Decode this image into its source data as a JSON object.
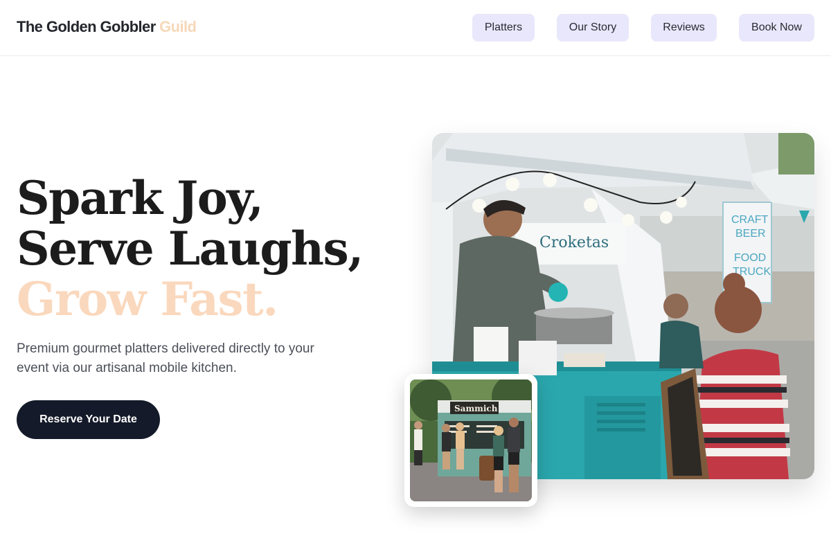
{
  "header": {
    "brand_main": "The Golden Gobbler",
    "brand_accent": "Guild",
    "nav": [
      {
        "label": "Platters"
      },
      {
        "label": "Our Story"
      },
      {
        "label": "Reviews"
      },
      {
        "label": "Book Now"
      }
    ]
  },
  "hero": {
    "headline_line1": "Spark Joy,",
    "headline_line2": "Serve Laughs,",
    "headline_line3": "Grow Fast.",
    "subtext": "Premium gourmet platters delivered directly to your event via our artisanal mobile kitchen.",
    "cta_label": "Reserve Your Date"
  },
  "photos": {
    "main_truck_sign": "Croketas",
    "small_truck_sign": "Sammich"
  },
  "colors": {
    "accent_peach": "#fad8bd",
    "nav_bg": "#e9e7fb",
    "cta_bg": "#141a29",
    "truck_teal": "#2aa7ad"
  }
}
